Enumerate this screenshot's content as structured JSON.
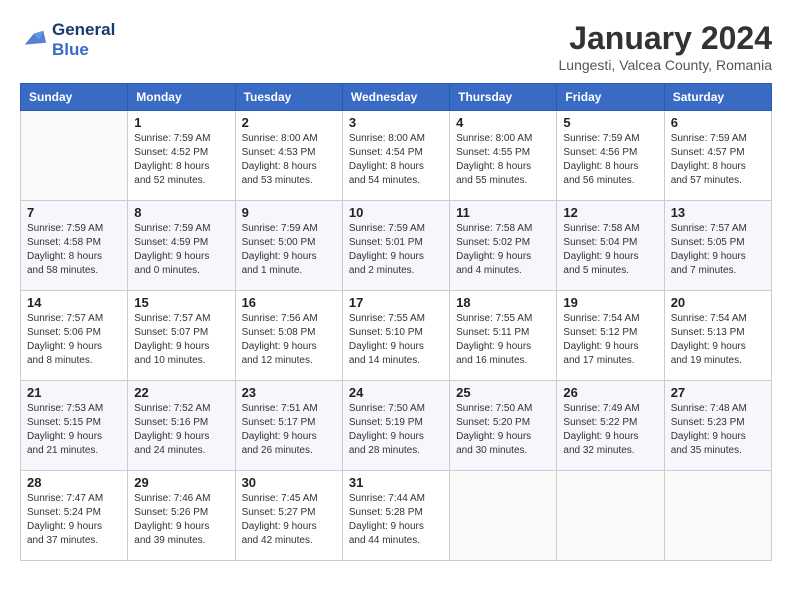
{
  "logo": {
    "line1": "General",
    "line2": "Blue"
  },
  "title": "January 2024",
  "subtitle": "Lungesti, Valcea County, Romania",
  "headers": [
    "Sunday",
    "Monday",
    "Tuesday",
    "Wednesday",
    "Thursday",
    "Friday",
    "Saturday"
  ],
  "weeks": [
    [
      {
        "day": "",
        "info": ""
      },
      {
        "day": "1",
        "info": "Sunrise: 7:59 AM\nSunset: 4:52 PM\nDaylight: 8 hours\nand 52 minutes."
      },
      {
        "day": "2",
        "info": "Sunrise: 8:00 AM\nSunset: 4:53 PM\nDaylight: 8 hours\nand 53 minutes."
      },
      {
        "day": "3",
        "info": "Sunrise: 8:00 AM\nSunset: 4:54 PM\nDaylight: 8 hours\nand 54 minutes."
      },
      {
        "day": "4",
        "info": "Sunrise: 8:00 AM\nSunset: 4:55 PM\nDaylight: 8 hours\nand 55 minutes."
      },
      {
        "day": "5",
        "info": "Sunrise: 7:59 AM\nSunset: 4:56 PM\nDaylight: 8 hours\nand 56 minutes."
      },
      {
        "day": "6",
        "info": "Sunrise: 7:59 AM\nSunset: 4:57 PM\nDaylight: 8 hours\nand 57 minutes."
      }
    ],
    [
      {
        "day": "7",
        "info": "Sunrise: 7:59 AM\nSunset: 4:58 PM\nDaylight: 8 hours\nand 58 minutes."
      },
      {
        "day": "8",
        "info": "Sunrise: 7:59 AM\nSunset: 4:59 PM\nDaylight: 9 hours\nand 0 minutes."
      },
      {
        "day": "9",
        "info": "Sunrise: 7:59 AM\nSunset: 5:00 PM\nDaylight: 9 hours\nand 1 minute."
      },
      {
        "day": "10",
        "info": "Sunrise: 7:59 AM\nSunset: 5:01 PM\nDaylight: 9 hours\nand 2 minutes."
      },
      {
        "day": "11",
        "info": "Sunrise: 7:58 AM\nSunset: 5:02 PM\nDaylight: 9 hours\nand 4 minutes."
      },
      {
        "day": "12",
        "info": "Sunrise: 7:58 AM\nSunset: 5:04 PM\nDaylight: 9 hours\nand 5 minutes."
      },
      {
        "day": "13",
        "info": "Sunrise: 7:57 AM\nSunset: 5:05 PM\nDaylight: 9 hours\nand 7 minutes."
      }
    ],
    [
      {
        "day": "14",
        "info": "Sunrise: 7:57 AM\nSunset: 5:06 PM\nDaylight: 9 hours\nand 8 minutes."
      },
      {
        "day": "15",
        "info": "Sunrise: 7:57 AM\nSunset: 5:07 PM\nDaylight: 9 hours\nand 10 minutes."
      },
      {
        "day": "16",
        "info": "Sunrise: 7:56 AM\nSunset: 5:08 PM\nDaylight: 9 hours\nand 12 minutes."
      },
      {
        "day": "17",
        "info": "Sunrise: 7:55 AM\nSunset: 5:10 PM\nDaylight: 9 hours\nand 14 minutes."
      },
      {
        "day": "18",
        "info": "Sunrise: 7:55 AM\nSunset: 5:11 PM\nDaylight: 9 hours\nand 16 minutes."
      },
      {
        "day": "19",
        "info": "Sunrise: 7:54 AM\nSunset: 5:12 PM\nDaylight: 9 hours\nand 17 minutes."
      },
      {
        "day": "20",
        "info": "Sunrise: 7:54 AM\nSunset: 5:13 PM\nDaylight: 9 hours\nand 19 minutes."
      }
    ],
    [
      {
        "day": "21",
        "info": "Sunrise: 7:53 AM\nSunset: 5:15 PM\nDaylight: 9 hours\nand 21 minutes."
      },
      {
        "day": "22",
        "info": "Sunrise: 7:52 AM\nSunset: 5:16 PM\nDaylight: 9 hours\nand 24 minutes."
      },
      {
        "day": "23",
        "info": "Sunrise: 7:51 AM\nSunset: 5:17 PM\nDaylight: 9 hours\nand 26 minutes."
      },
      {
        "day": "24",
        "info": "Sunrise: 7:50 AM\nSunset: 5:19 PM\nDaylight: 9 hours\nand 28 minutes."
      },
      {
        "day": "25",
        "info": "Sunrise: 7:50 AM\nSunset: 5:20 PM\nDaylight: 9 hours\nand 30 minutes."
      },
      {
        "day": "26",
        "info": "Sunrise: 7:49 AM\nSunset: 5:22 PM\nDaylight: 9 hours\nand 32 minutes."
      },
      {
        "day": "27",
        "info": "Sunrise: 7:48 AM\nSunset: 5:23 PM\nDaylight: 9 hours\nand 35 minutes."
      }
    ],
    [
      {
        "day": "28",
        "info": "Sunrise: 7:47 AM\nSunset: 5:24 PM\nDaylight: 9 hours\nand 37 minutes."
      },
      {
        "day": "29",
        "info": "Sunrise: 7:46 AM\nSunset: 5:26 PM\nDaylight: 9 hours\nand 39 minutes."
      },
      {
        "day": "30",
        "info": "Sunrise: 7:45 AM\nSunset: 5:27 PM\nDaylight: 9 hours\nand 42 minutes."
      },
      {
        "day": "31",
        "info": "Sunrise: 7:44 AM\nSunset: 5:28 PM\nDaylight: 9 hours\nand 44 minutes."
      },
      {
        "day": "",
        "info": ""
      },
      {
        "day": "",
        "info": ""
      },
      {
        "day": "",
        "info": ""
      }
    ]
  ]
}
